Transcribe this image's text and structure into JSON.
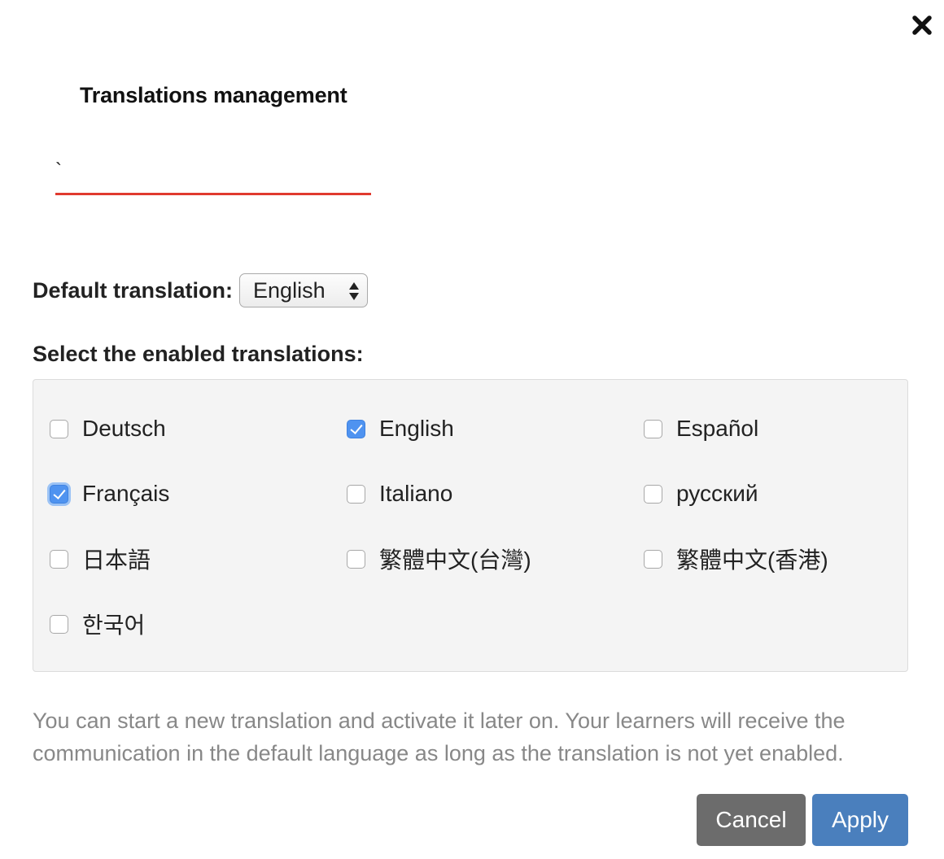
{
  "dialog": {
    "title": "Translations management",
    "close_icon": "close-x-icon"
  },
  "name_field": {
    "value": "`"
  },
  "default_translation": {
    "label": "Default translation:",
    "selected": "English"
  },
  "enabled_section": {
    "label": "Select the enabled translations:",
    "languages": [
      {
        "label": "Deutsch",
        "checked": false
      },
      {
        "label": "English",
        "checked": true
      },
      {
        "label": "Español",
        "checked": false
      },
      {
        "label": "Français",
        "checked": true
      },
      {
        "label": "Italiano",
        "checked": false
      },
      {
        "label": "русский",
        "checked": false
      },
      {
        "label": "日本語",
        "checked": false
      },
      {
        "label": "繁體中文(台灣)",
        "checked": false
      },
      {
        "label": "繁體中文(香港)",
        "checked": false
      },
      {
        "label": "한국어",
        "checked": false
      }
    ]
  },
  "help_text": "You can start a new translation and activate it later on. Your learners will receive the communication in the default language as long as the translation is not yet enabled.",
  "buttons": {
    "cancel": "Cancel",
    "apply": "Apply"
  },
  "colors": {
    "accent_underline": "#e03a2f",
    "checkbox_checked": "#4f93f0",
    "cancel_bg": "#6c6c6c",
    "apply_bg": "#4a7fbd"
  }
}
